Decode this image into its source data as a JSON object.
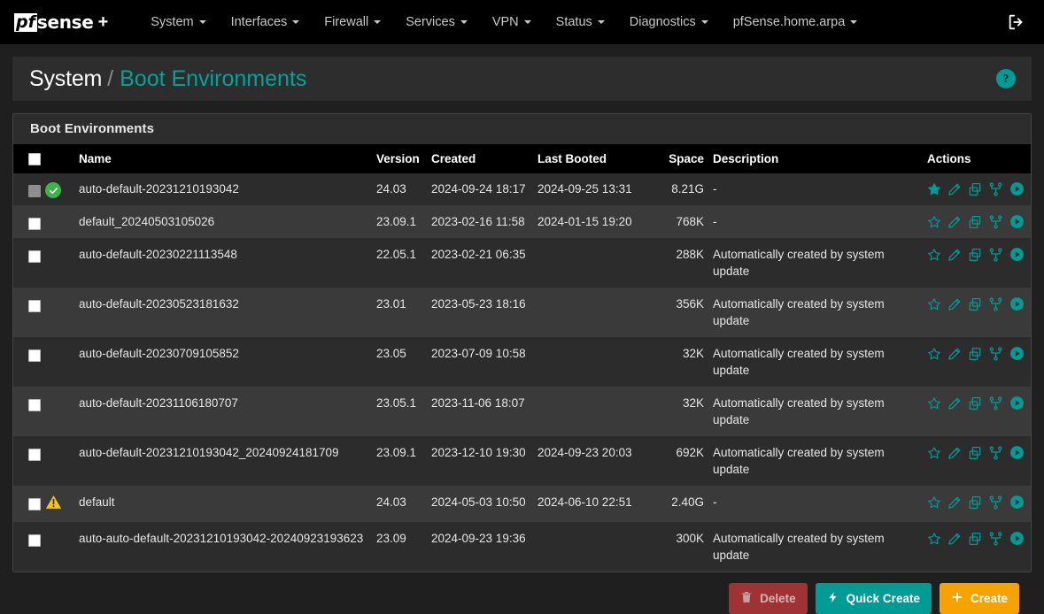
{
  "navbar": {
    "brand_logo": "pf",
    "brand_text": "sense",
    "brand_plus": "+",
    "items": [
      {
        "label": "System",
        "has_caret": true
      },
      {
        "label": "Interfaces",
        "has_caret": true
      },
      {
        "label": "Firewall",
        "has_caret": true
      },
      {
        "label": "Services",
        "has_caret": true
      },
      {
        "label": "VPN",
        "has_caret": true
      },
      {
        "label": "Status",
        "has_caret": true
      },
      {
        "label": "Diagnostics",
        "has_caret": true
      },
      {
        "label": "pfSense.home.arpa",
        "has_caret": true
      }
    ],
    "logout_icon": "sign-out-icon"
  },
  "header": {
    "breadcrumb_parent": "System",
    "breadcrumb_separator": "/",
    "breadcrumb_current": "Boot Environments",
    "help_label": "?"
  },
  "panel": {
    "title": "Boot Environments"
  },
  "table": {
    "columns": [
      "",
      "",
      "Name",
      "Version",
      "Created",
      "Last Booted",
      "Space",
      "Description",
      "Actions"
    ],
    "headers": {
      "name": "Name",
      "version": "Version",
      "created": "Created",
      "last_booted": "Last Booted",
      "space": "Space",
      "description": "Description",
      "actions": "Actions"
    },
    "rows": [
      {
        "status": "active",
        "checkbox_disabled": true,
        "name": "auto-default-20231210193042",
        "version": "24.03",
        "created": "2024-09-24 18:17",
        "last_booted": "2024-09-25 13:31",
        "space": "8.21G",
        "description": "-",
        "starred": true,
        "deletable": false
      },
      {
        "status": "none",
        "checkbox_disabled": false,
        "name": "default_20240503105026",
        "version": "23.09.1",
        "created": "2023-02-16 11:58",
        "last_booted": "2024-01-15 19:20",
        "space": "768K",
        "description": "-",
        "starred": false,
        "deletable": true
      },
      {
        "status": "none",
        "checkbox_disabled": false,
        "name": "auto-default-20230221113548",
        "version": "22.05.1",
        "created": "2023-02-21 06:35",
        "last_booted": "",
        "space": "288K",
        "description": "Automatically created by system update",
        "starred": false,
        "deletable": true
      },
      {
        "status": "none",
        "checkbox_disabled": false,
        "name": "auto-default-20230523181632",
        "version": "23.01",
        "created": "2023-05-23 18:16",
        "last_booted": "",
        "space": "356K",
        "description": "Automatically created by system update",
        "starred": false,
        "deletable": true
      },
      {
        "status": "none",
        "checkbox_disabled": false,
        "name": "auto-default-20230709105852",
        "version": "23.05",
        "created": "2023-07-09 10:58",
        "last_booted": "",
        "space": "32K",
        "description": "Automatically created by system update",
        "starred": false,
        "deletable": true
      },
      {
        "status": "none",
        "checkbox_disabled": false,
        "name": "auto-default-20231106180707",
        "version": "23.05.1",
        "created": "2023-11-06 18:07",
        "last_booted": "",
        "space": "32K",
        "description": "Automatically created by system update",
        "starred": false,
        "deletable": true
      },
      {
        "status": "none",
        "checkbox_disabled": false,
        "name": "auto-default-20231210193042_20240924181709",
        "version": "23.09.1",
        "created": "2023-12-10 19:30",
        "last_booted": "2024-09-23 20:03",
        "space": "692K",
        "description": "Automatically created by system update",
        "starred": false,
        "deletable": true
      },
      {
        "status": "warning",
        "checkbox_disabled": false,
        "name": "default",
        "version": "24.03",
        "created": "2024-05-03 10:50",
        "last_booted": "2024-06-10 22:51",
        "space": "2.40G",
        "description": "-",
        "starred": false,
        "deletable": true
      },
      {
        "status": "none",
        "checkbox_disabled": false,
        "name": "auto-auto-default-20231210193042-20240923193623",
        "version": "23.09",
        "created": "2024-09-23 19:36",
        "last_booted": "",
        "space": "300K",
        "description": "Automatically created by system update",
        "starred": false,
        "deletable": true
      }
    ],
    "action_icons": [
      "star-icon",
      "pencil-icon",
      "clone-icon",
      "sitemap-icon",
      "play-icon",
      "trash-icon"
    ]
  },
  "footer": {
    "delete_label": "Delete",
    "quick_create_label": "Quick Create",
    "create_label": "Create"
  },
  "colors": {
    "accent_teal": "#009b94",
    "danger_red": "#d9201f",
    "warning_orange": "#f6a200",
    "success_green": "#3bb54a",
    "navbar_bg": "#000000",
    "page_bg": "#1f1f1f"
  }
}
